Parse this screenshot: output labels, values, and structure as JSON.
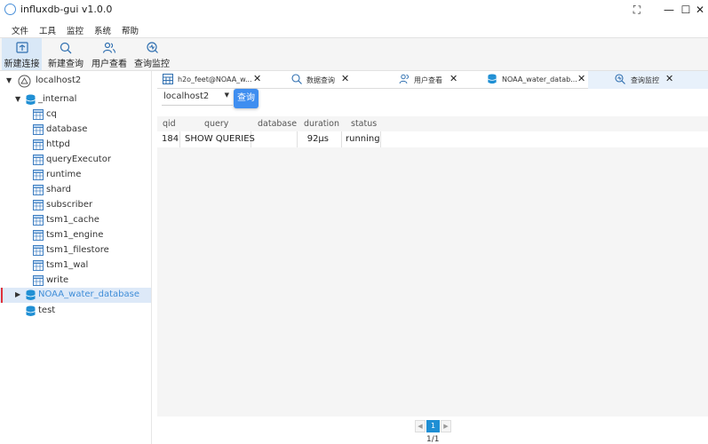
{
  "window": {
    "title": "influxdb-gui v1.0.0",
    "fullscreen_glyph": "⛶",
    "minimize_glyph": "—",
    "maximize_glyph": "☐",
    "close_glyph": "✕"
  },
  "menu": [
    "文件",
    "工具",
    "监控",
    "系统",
    "帮助"
  ],
  "toolbar": [
    {
      "label": "新建连接",
      "icon": "new-connection-icon",
      "active": true
    },
    {
      "label": "新建查询",
      "icon": "search-icon",
      "active": false
    },
    {
      "label": "用户查看",
      "icon": "users-icon",
      "active": false
    },
    {
      "label": "查询监控",
      "icon": "query-monitor-icon",
      "active": false
    }
  ],
  "tree": {
    "connection": "localhost2",
    "internal_db": "_internal",
    "measurements": [
      "cq",
      "database",
      "httpd",
      "queryExecutor",
      "runtime",
      "shard",
      "subscriber",
      "tsm1_cache",
      "tsm1_engine",
      "tsm1_filestore",
      "tsm1_wal",
      "write"
    ],
    "noaa_db": "NOAA_water_database",
    "test_db": "test"
  },
  "tabs": [
    {
      "label": "h2o_feet@NOAA_w...",
      "icon": "table-icon",
      "close": "✕"
    },
    {
      "label": "数据查询",
      "icon": "search-icon",
      "close": "✕"
    },
    {
      "label": "用户查看",
      "icon": "users-icon",
      "close": "✕"
    },
    {
      "label": "NOAA_water_datab...",
      "icon": "database-icon",
      "close": "✕"
    },
    {
      "label": "查询监控",
      "icon": "query-monitor-icon",
      "close": "✕",
      "active": true
    }
  ],
  "query_panel": {
    "connection_select": "localhost2",
    "query_button": "查询",
    "columns": [
      "qid",
      "query",
      "database",
      "duration",
      "status"
    ],
    "rows": [
      {
        "qid": "184",
        "query": "SHOW QUERIES",
        "database": "",
        "duration": "92µs",
        "status": "running"
      }
    ]
  },
  "pagination": {
    "current": "1",
    "total": "1/1",
    "prev": "◀",
    "next": "▶"
  },
  "colors": {
    "accent": "#3f8ef0",
    "selected_bg": "#dde9f8",
    "db_icon": "#1f8fd4",
    "marker": "#e0303a"
  }
}
